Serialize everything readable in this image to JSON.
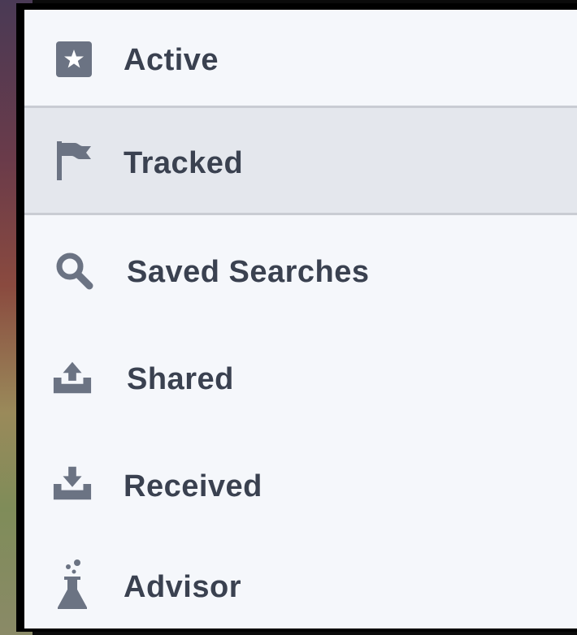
{
  "sidebar": {
    "items": [
      {
        "label": "Active",
        "icon": "star-box-icon"
      },
      {
        "label": "Tracked",
        "icon": "flag-icon",
        "selected": true
      },
      {
        "label": "Saved Searches",
        "icon": "search-icon"
      },
      {
        "label": "Shared",
        "icon": "upload-tray-icon"
      },
      {
        "label": "Received",
        "icon": "download-tray-icon"
      },
      {
        "label": "Advisor",
        "icon": "flask-icon"
      }
    ]
  },
  "colors": {
    "panel_bg": "#f5f7fb",
    "selected_bg": "#e4e7ed",
    "text": "#3a4150",
    "icon": "#6b7383"
  }
}
